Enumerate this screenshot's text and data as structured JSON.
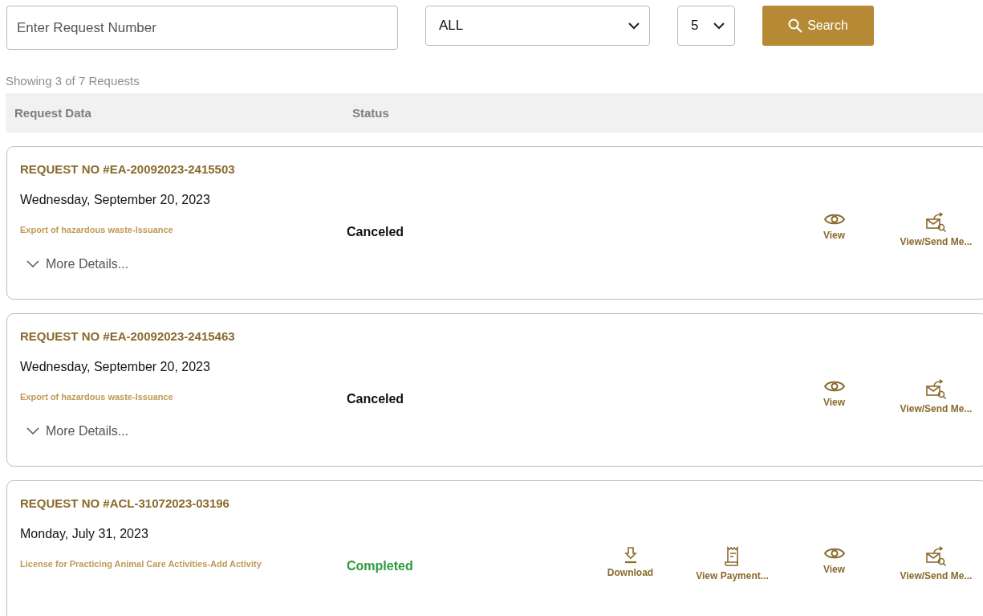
{
  "search": {
    "placeholder": "Enter Request Number",
    "status_filter": "ALL",
    "page_size": "5",
    "button": "Search"
  },
  "summary": "Showing 3 of 7 Requests",
  "table": {
    "columns": [
      "Request Data",
      "Status"
    ]
  },
  "requests": [
    {
      "number": "REQUEST NO #EA-20092023-2415503",
      "date": "Wednesday, September 20, 2023",
      "service": "Export of hazardous waste-Issuance",
      "status": {
        "label": "Canceled",
        "kind": "canceled"
      },
      "more_details": "More Details...",
      "actions": [
        {
          "kind": "view",
          "label": "View"
        },
        {
          "kind": "message",
          "label": "View/Send Me..."
        }
      ]
    },
    {
      "number": "REQUEST NO #EA-20092023-2415463",
      "date": "Wednesday, September 20, 2023",
      "service": "Export of hazardous waste-Issuance",
      "status": {
        "label": "Canceled",
        "kind": "canceled"
      },
      "more_details": "More Details...",
      "actions": [
        {
          "kind": "view",
          "label": "View"
        },
        {
          "kind": "message",
          "label": "View/Send Me..."
        }
      ]
    },
    {
      "number": "REQUEST NO #ACL-31072023-03196",
      "date": "Monday, July 31, 2023",
      "service": "License for Practicing Animal Care Activities-Add Activity",
      "status": {
        "label": "Completed",
        "kind": "completed"
      },
      "actions": [
        {
          "kind": "download",
          "label": "Download"
        },
        {
          "kind": "payment",
          "label": "View Payment..."
        },
        {
          "kind": "view",
          "label": "View"
        },
        {
          "kind": "message",
          "label": "View/Send Me..."
        }
      ]
    }
  ]
}
